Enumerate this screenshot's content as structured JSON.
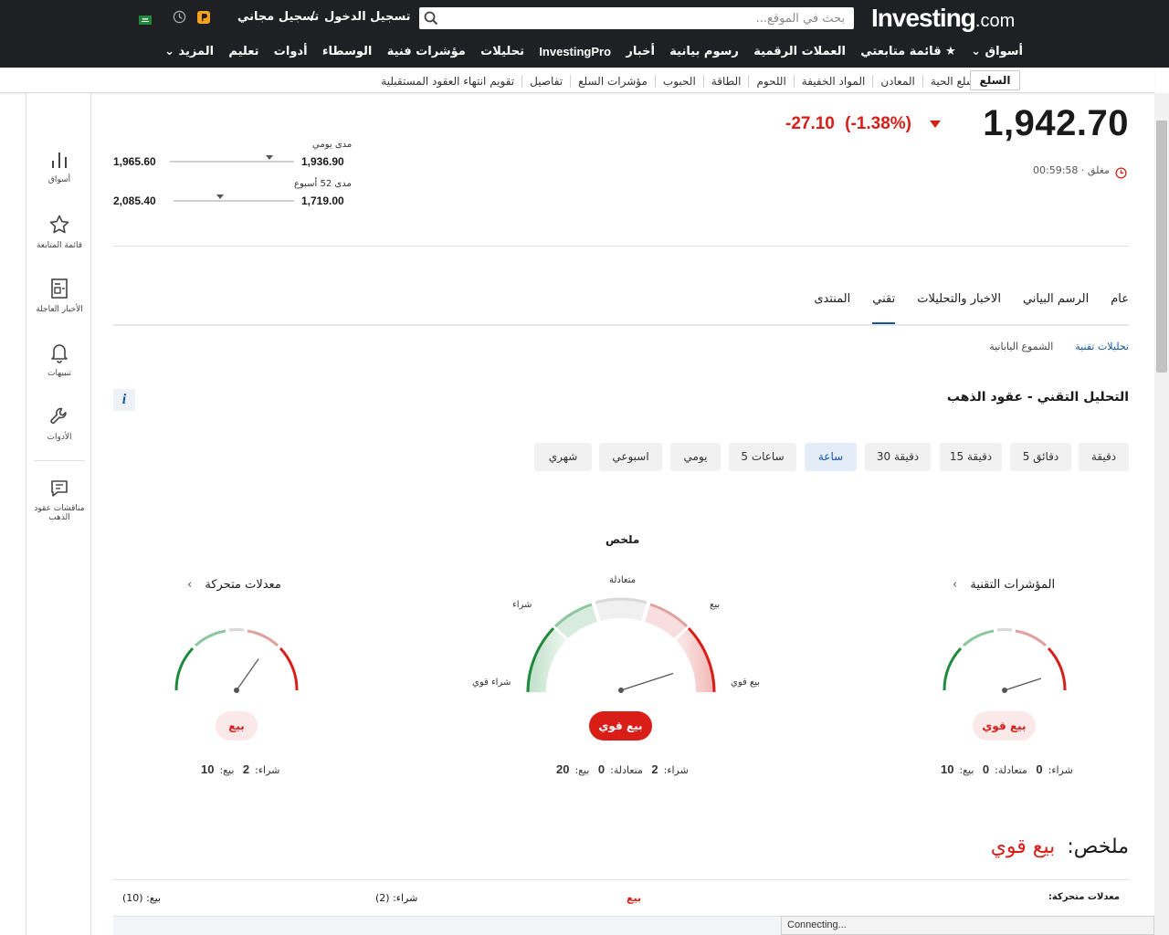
{
  "header": {
    "logo_main": "Investing",
    "logo_suffix": ".com",
    "search_placeholder": "بحث في الموقع...",
    "login": "تسجيل الدخول",
    "separator": "/",
    "register": "تسجيل مجاني",
    "nav": [
      "أسواق ⌄",
      "★ قائمة متابعتي",
      "العملات الرقمية",
      "رسوم بيانية",
      "أخبار",
      "InvestingPro",
      "تحليلات",
      "مؤشرات فنية",
      "الوسطاء",
      "أدوات",
      "تعليم",
      "المزيد ⌄"
    ]
  },
  "subnav": {
    "active": "السلع",
    "items": [
      "اسعار السلع الحية",
      "المعادن",
      "المواد الخفيفة",
      "اللحوم",
      "الطاقة",
      "الحبوب",
      "مؤشرات السلع",
      "تفاصيل",
      "تقويم انتهاء العقود المستقبلية"
    ]
  },
  "sidebar": [
    {
      "label": "أسواق",
      "icon": "bar-chart-icon"
    },
    {
      "label": "قائمة المتابعة",
      "icon": "star-icon"
    },
    {
      "label": "الأخبار العاجلة",
      "icon": "news-icon"
    },
    {
      "label": "تنبيهات",
      "icon": "bell-icon"
    },
    {
      "label": "الأدوات",
      "icon": "wrench-icon"
    },
    {
      "label1": "مناقشات عقود",
      "label2": "الذهب",
      "icon": "comment-icon"
    }
  ],
  "quote": {
    "price": "1,942.70",
    "change": "-27.10",
    "change_pct": "(-1.38%)",
    "status": "مغلق",
    "time": "00:59:58",
    "day_range_label": "مدى يومي",
    "day_low": "1,936.90",
    "day_high": "1,965.60",
    "day_position": 0.2,
    "week52_label": "مدى 52 أسبوع",
    "week52_low": "1,719.00",
    "week52_high": "2,085.40",
    "week52_position": 0.61
  },
  "tabs": [
    {
      "label": "عام",
      "active": false
    },
    {
      "label": "الرسم البياني",
      "active": false
    },
    {
      "label": "الاخبار والتحليلات",
      "active": false
    },
    {
      "label": "تقني",
      "active": true
    },
    {
      "label": "المنتدى",
      "active": false
    }
  ],
  "subtabs": [
    {
      "label": "تحليلات تقنية",
      "active": true
    },
    {
      "label": "الشموع اليابانية",
      "active": false
    }
  ],
  "technical": {
    "title": "التحليل التقني - عقود الذهب",
    "info": "i",
    "timeframes": [
      "دقيقة",
      "5 دقائق",
      "15 دقيقة",
      "30 دقيقة",
      "ساعة",
      "5 ساعات",
      "يومي",
      "اسبوعي",
      "شهري"
    ],
    "active_timeframe": "ساعة",
    "summary_heading": "ملخص",
    "gauge_labels": {
      "neutral": "متعادلة",
      "buy": "شراء",
      "sell": "بيع",
      "strong_buy": "شراء قوي",
      "strong_sell": "بيع قوي"
    },
    "indicators": {
      "title": "المؤشرات التقنية",
      "chevron": "›",
      "verdict": "بيع قوي",
      "buy": "0",
      "neutral": "0",
      "sell": "10"
    },
    "summary": {
      "verdict": "بيع قوي",
      "buy": "2",
      "neutral": "0",
      "sell": "20"
    },
    "moving_averages": {
      "title": "معدلات متحركة",
      "chevron": "›",
      "verdict": "بيع",
      "buy": "2",
      "sell": "10"
    },
    "count_labels": {
      "buy": "شراء:",
      "neutral": "متعادلة:",
      "sell": "بيع:"
    },
    "summary_line_label": "ملخص:",
    "summary_line_value": "بيع قوي",
    "rows": [
      {
        "name": "معدلات متحركة:",
        "verdict": "بيع",
        "buy": "شراء: (2)",
        "sell": "بيع: (10)"
      }
    ]
  },
  "status_bar": "Connecting...",
  "colors": {
    "header_bg": "#1f2023",
    "sell": "#d91e18",
    "buy": "#1e8a3c",
    "accent": "#1256a0",
    "pro_orange": "#f7a21b"
  }
}
